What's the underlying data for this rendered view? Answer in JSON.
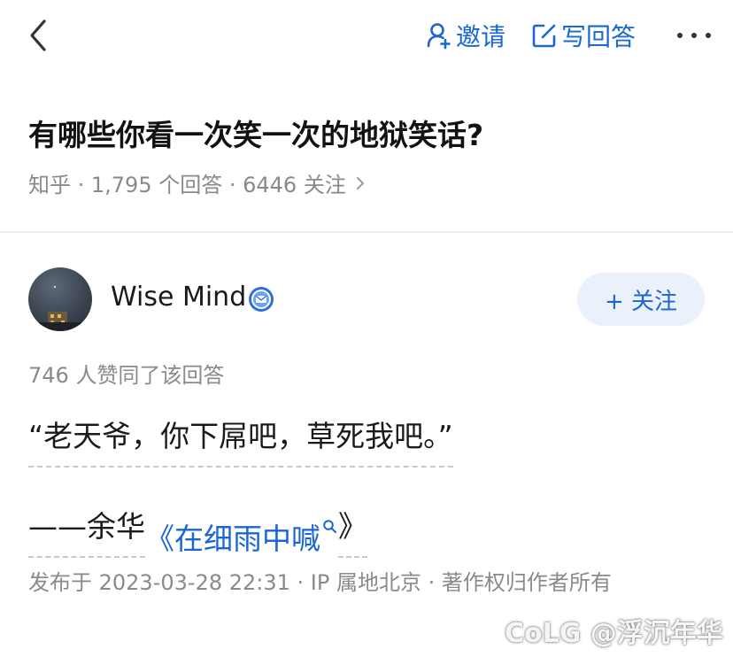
{
  "topbar": {
    "back_icon": "chevron-left-icon",
    "invite_label": "邀请",
    "invite_icon": "person-add-icon",
    "write_label": "写回答",
    "write_icon": "edit-icon",
    "more_icon": "more-horizontal-icon"
  },
  "question": {
    "title": "有哪些你看一次笑一次的地狱笑话?",
    "meta": "知乎 · 1,795 个回答 · 6446 关注"
  },
  "author": {
    "name": "Wise Mind",
    "follow_label": "+ 关注",
    "badge_icon": "verified-badge-icon"
  },
  "answer": {
    "votes": "746 人赞同了该回答",
    "quote": "“老天爷，你下屌吧，草死我吧。”",
    "attribution_prefix": "——余华",
    "book_title": "《在细雨中喊",
    "book_title_end": "》",
    "published": "发布于 2023-03-28 22:31 · IP 属地北京 · 著作权归作者所有"
  },
  "watermark": "CoLG @浮沉年华",
  "colors": {
    "accent": "#1a66d4",
    "follow_bg": "#eaf1fb",
    "muted_text": "#8a8a8a",
    "primary_text": "#1a1a1a"
  }
}
